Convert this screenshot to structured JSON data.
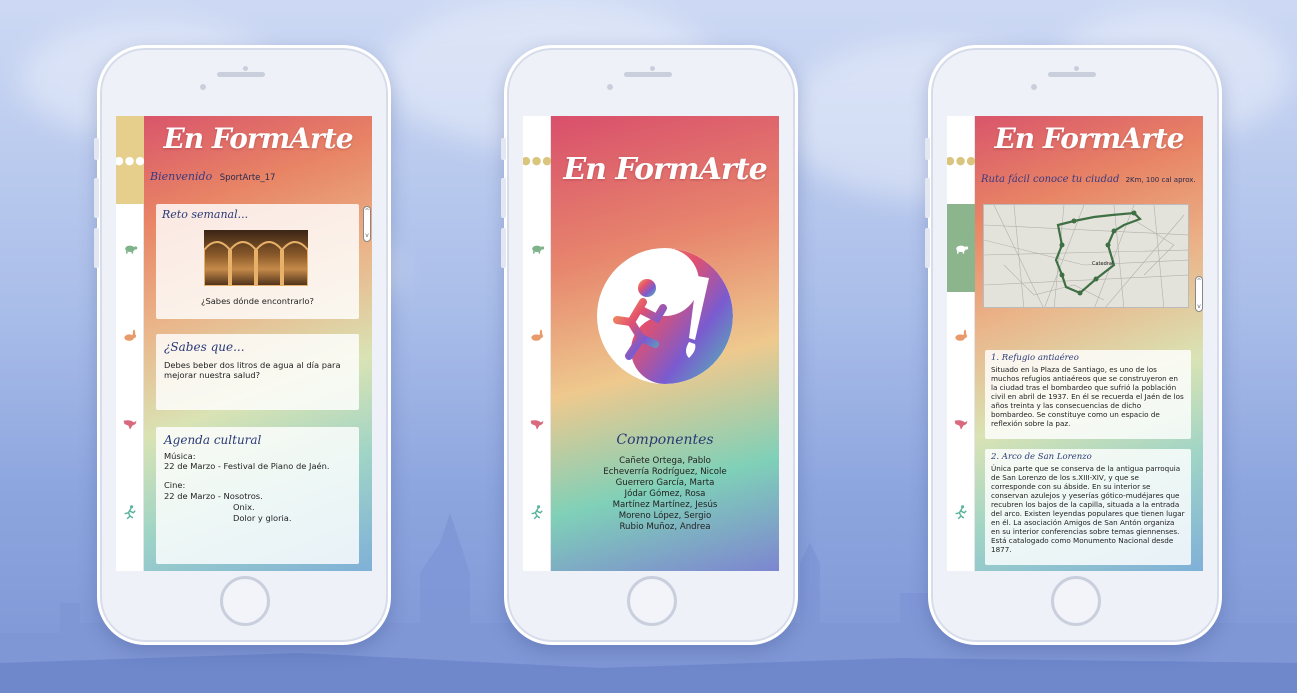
{
  "app": {
    "name": "En FormArte"
  },
  "tabs": [
    {
      "icon": "menu-dots-icon"
    },
    {
      "icon": "turtle-icon"
    },
    {
      "icon": "rabbit-icon"
    },
    {
      "icon": "puma-icon"
    },
    {
      "icon": "runner-icon"
    }
  ],
  "screen_home": {
    "greeting": "Bienvenido",
    "username": "SportArte_17",
    "weekly_challenge": {
      "title": "Reto semanal...",
      "caption": "¿Sabes dónde encontrarlo?"
    },
    "did_you_know": {
      "title": "¿Sabes que...",
      "text": "Debes beber dos litros de agua al día para mejorar nuestra salud?"
    },
    "agenda": {
      "title": "Agenda cultural",
      "music_label": "Música:",
      "music_item": "22 de Marzo - Festival de Piano de Jaén.",
      "cinema_label": "Cine:",
      "cinema_item": "22 de Marzo - Nosotros.",
      "cinema_more_1": "Onix.",
      "cinema_more_2": "Dolor y gloria."
    }
  },
  "screen_splash": {
    "components_title": "Componentes",
    "members": [
      "Cañete Ortega, Pablo",
      "Echeverría Rodríguez, Nicole",
      "Guerrero García, Marta",
      "Jódar Gómez, Rosa",
      "Martínez Martínez, Jesús",
      "Moreno López, Sergio",
      "Rubio Muñoz, Andrea"
    ]
  },
  "screen_route": {
    "route_title": "Ruta fácil conoce tu ciudad",
    "route_info": "2Km, 100 cal aprox.",
    "map_label": "Catedral",
    "stop1": {
      "title": "1. Refugio antiaéreo",
      "text": "Situado en la Plaza de Santiago, es uno de los muchos refugios antiaéreos que se construyeron en la ciudad tras el bombardeo que sufrió la población civil en abril de 1937. En él se recuerda el Jaén de los años treinta y las consecuencias de dicho bombardeo. Se constituye como un espacio de reflexión sobre la paz."
    },
    "stop2": {
      "title": "2. Arco de San Lorenzo",
      "text": "Única parte que se conserva de la antigua parroquia de San Lorenzo de los s.XIII-XIV, y que se corresponde con su ábside. En su interior se conservan azulejos y yeserías gótico-mudéjares que recubren los bajos de la capilla, situada a la entrada del arco. Existen leyendas populares que tienen lugar en él. La asociación Amigos de San Antón organiza en su interior conferencias sobre temas giennenses. Está catalogado como Monumento Nacional desde 1877."
    }
  },
  "colors": {
    "accent_gold": "#e6cf8d",
    "accent_green": "#8cb48d",
    "handwriting_blue": "#2a3a78"
  }
}
